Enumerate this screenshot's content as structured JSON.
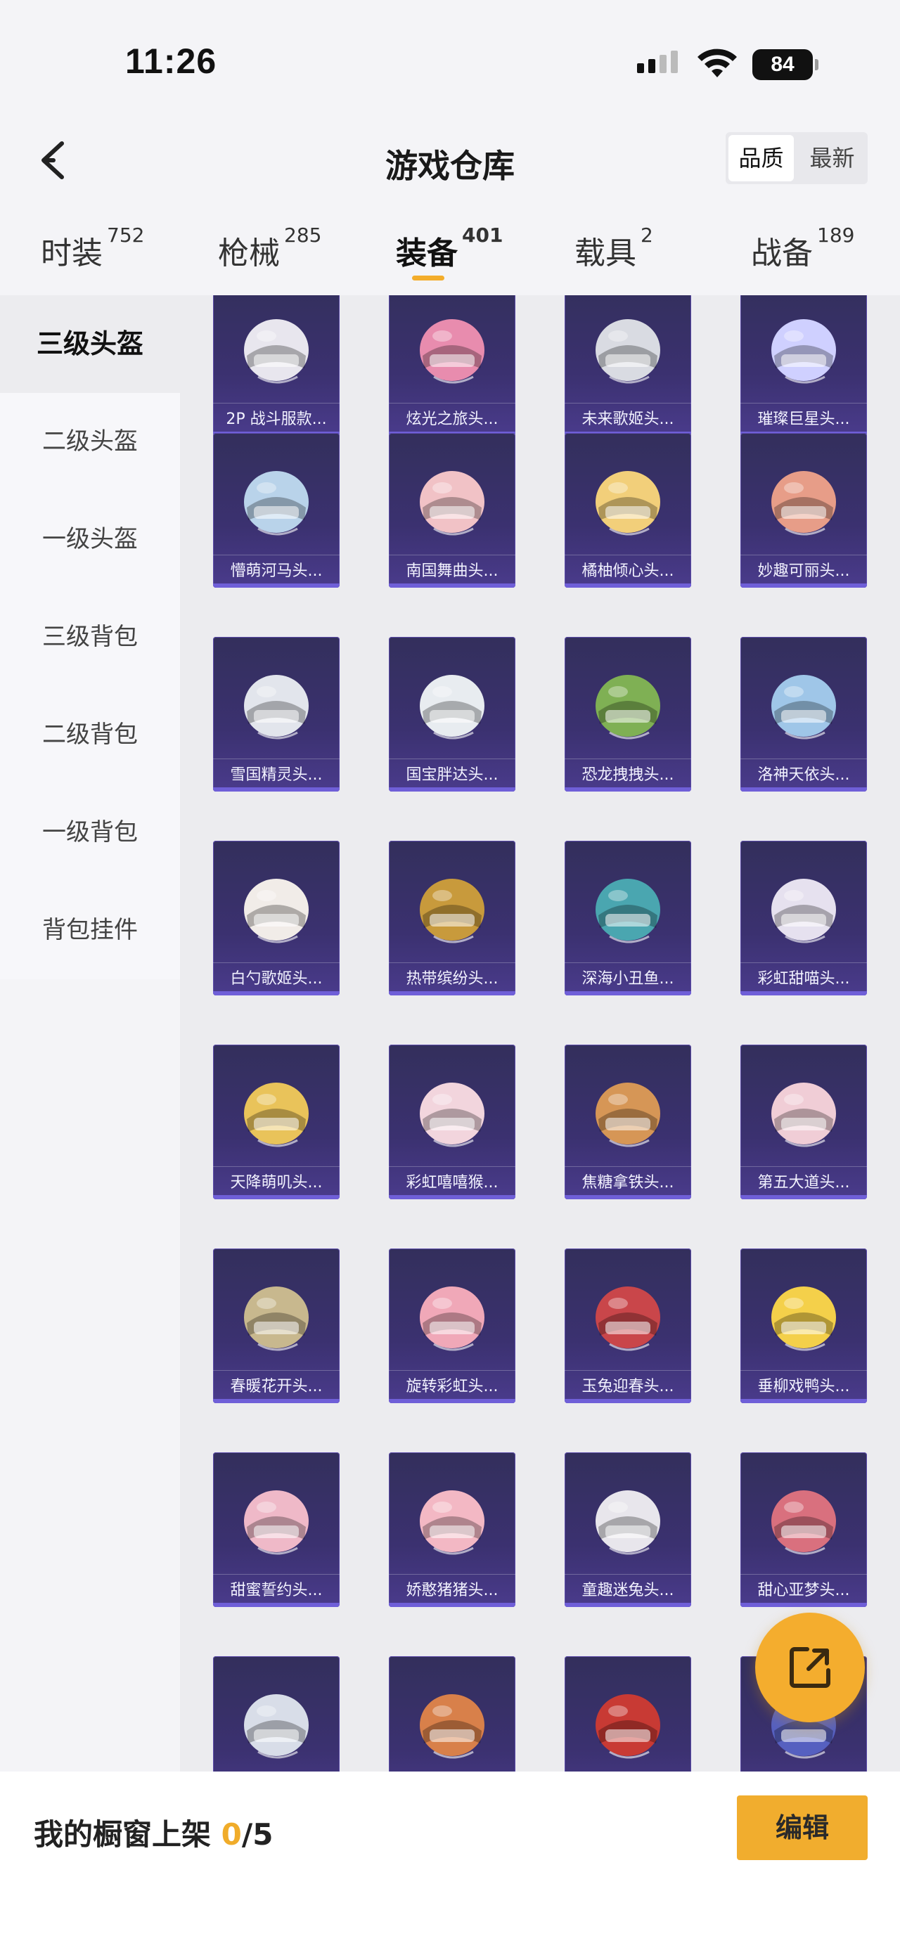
{
  "status_bar": {
    "time": "11:26",
    "battery": "84"
  },
  "header": {
    "title": "游戏仓库",
    "sort_options": [
      "品质",
      "最新"
    ],
    "sort_selected": "品质"
  },
  "tabs": [
    {
      "label": "时装",
      "count": "752"
    },
    {
      "label": "枪械",
      "count": "285"
    },
    {
      "label": "装备",
      "count": "401"
    },
    {
      "label": "载具",
      "count": "2"
    },
    {
      "label": "战备",
      "count": "189"
    }
  ],
  "active_tab": "装备",
  "sidebar": {
    "items": [
      "三级头盔",
      "二级头盔",
      "一级头盔",
      "三级背包",
      "二级背包",
      "一级背包",
      "背包挂件"
    ],
    "active": "三级头盔"
  },
  "grid": {
    "rows": [
      [
        "2P 战斗服款...",
        "炫光之旅头...",
        "未来歌姬头...",
        "璀璨巨星头..."
      ],
      [
        "懵萌河马头...",
        "南国舞曲头...",
        "橘柚倾心头...",
        "妙趣可丽头..."
      ],
      [
        "雪国精灵头...",
        "国宝胖达头...",
        "恐龙拽拽头...",
        "洛神天依头..."
      ],
      [
        "白勺歌姬头...",
        "热带缤纷头...",
        "深海小丑鱼...",
        "彩虹甜喵头..."
      ],
      [
        "天降萌叽头...",
        "彩虹嘻嘻猴...",
        "焦糖拿铁头...",
        "第五大道头..."
      ],
      [
        "春暖花开头...",
        "旋转彩虹头...",
        "玉兔迎春头...",
        "垂柳戏鸭头..."
      ],
      [
        "甜蜜誓约头...",
        "娇憨猪猪头...",
        "童趣迷兔头...",
        "甜心亚梦头..."
      ],
      [
        "",
        "",
        "",
        ""
      ]
    ],
    "colors": [
      [
        "#e8e6ee",
        "#e88cae",
        "#d9dbe2",
        "#cfd0ff"
      ],
      [
        "#b9d3ea",
        "#f1c2c6",
        "#f2cf7a",
        "#e79d88"
      ],
      [
        "#e2e5ec",
        "#e8ecf0",
        "#7fb054",
        "#9fc6e8"
      ],
      [
        "#f1ece8",
        "#c89a3c",
        "#4aa6b0",
        "#e6e1ef"
      ],
      [
        "#e9c35a",
        "#f2d5dd",
        "#d69656",
        "#f0cdd6"
      ],
      [
        "#c8b88e",
        "#f0a8b8",
        "#c9464a",
        "#f4d04a"
      ],
      [
        "#efb9c8",
        "#f3b8c4",
        "#e8e6ec",
        "#d9707e"
      ],
      [
        "#d8dde8",
        "#d8804a",
        "#c83a34",
        "#5660c0"
      ]
    ]
  },
  "bottom_bar": {
    "shelf_label": "我的橱窗上架",
    "shelf_count": "0",
    "shelf_total": "/5",
    "edit_label": "编辑"
  },
  "fab_icon": "share-icon"
}
